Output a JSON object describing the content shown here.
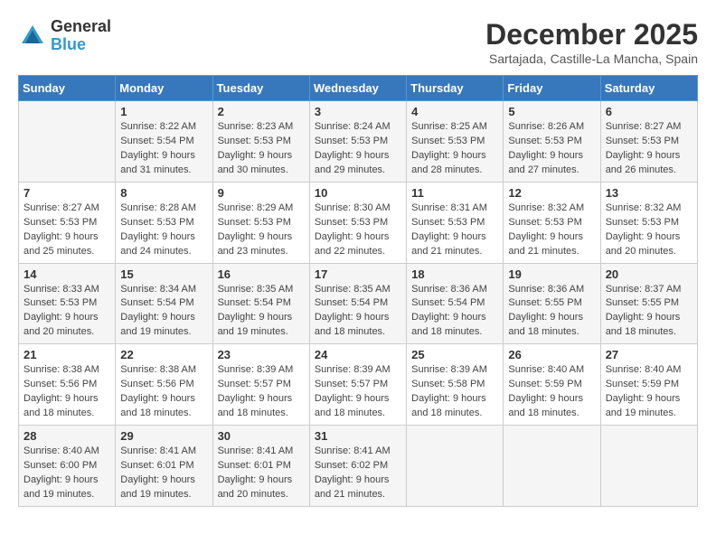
{
  "header": {
    "logo": {
      "general": "General",
      "blue": "Blue"
    },
    "title": "December 2025",
    "location": "Sartajada, Castille-La Mancha, Spain"
  },
  "days_of_week": [
    "Sunday",
    "Monday",
    "Tuesday",
    "Wednesday",
    "Thursday",
    "Friday",
    "Saturday"
  ],
  "weeks": [
    [
      {
        "day": "",
        "info": ""
      },
      {
        "day": "1",
        "info": "Sunrise: 8:22 AM\nSunset: 5:54 PM\nDaylight: 9 hours\nand 31 minutes."
      },
      {
        "day": "2",
        "info": "Sunrise: 8:23 AM\nSunset: 5:53 PM\nDaylight: 9 hours\nand 30 minutes."
      },
      {
        "day": "3",
        "info": "Sunrise: 8:24 AM\nSunset: 5:53 PM\nDaylight: 9 hours\nand 29 minutes."
      },
      {
        "day": "4",
        "info": "Sunrise: 8:25 AM\nSunset: 5:53 PM\nDaylight: 9 hours\nand 28 minutes."
      },
      {
        "day": "5",
        "info": "Sunrise: 8:26 AM\nSunset: 5:53 PM\nDaylight: 9 hours\nand 27 minutes."
      },
      {
        "day": "6",
        "info": "Sunrise: 8:27 AM\nSunset: 5:53 PM\nDaylight: 9 hours\nand 26 minutes."
      }
    ],
    [
      {
        "day": "7",
        "info": "Sunrise: 8:27 AM\nSunset: 5:53 PM\nDaylight: 9 hours\nand 25 minutes."
      },
      {
        "day": "8",
        "info": "Sunrise: 8:28 AM\nSunset: 5:53 PM\nDaylight: 9 hours\nand 24 minutes."
      },
      {
        "day": "9",
        "info": "Sunrise: 8:29 AM\nSunset: 5:53 PM\nDaylight: 9 hours\nand 23 minutes."
      },
      {
        "day": "10",
        "info": "Sunrise: 8:30 AM\nSunset: 5:53 PM\nDaylight: 9 hours\nand 22 minutes."
      },
      {
        "day": "11",
        "info": "Sunrise: 8:31 AM\nSunset: 5:53 PM\nDaylight: 9 hours\nand 21 minutes."
      },
      {
        "day": "12",
        "info": "Sunrise: 8:32 AM\nSunset: 5:53 PM\nDaylight: 9 hours\nand 21 minutes."
      },
      {
        "day": "13",
        "info": "Sunrise: 8:32 AM\nSunset: 5:53 PM\nDaylight: 9 hours\nand 20 minutes."
      }
    ],
    [
      {
        "day": "14",
        "info": "Sunrise: 8:33 AM\nSunset: 5:53 PM\nDaylight: 9 hours\nand 20 minutes."
      },
      {
        "day": "15",
        "info": "Sunrise: 8:34 AM\nSunset: 5:54 PM\nDaylight: 9 hours\nand 19 minutes."
      },
      {
        "day": "16",
        "info": "Sunrise: 8:35 AM\nSunset: 5:54 PM\nDaylight: 9 hours\nand 19 minutes."
      },
      {
        "day": "17",
        "info": "Sunrise: 8:35 AM\nSunset: 5:54 PM\nDaylight: 9 hours\nand 18 minutes."
      },
      {
        "day": "18",
        "info": "Sunrise: 8:36 AM\nSunset: 5:54 PM\nDaylight: 9 hours\nand 18 minutes."
      },
      {
        "day": "19",
        "info": "Sunrise: 8:36 AM\nSunset: 5:55 PM\nDaylight: 9 hours\nand 18 minutes."
      },
      {
        "day": "20",
        "info": "Sunrise: 8:37 AM\nSunset: 5:55 PM\nDaylight: 9 hours\nand 18 minutes."
      }
    ],
    [
      {
        "day": "21",
        "info": "Sunrise: 8:38 AM\nSunset: 5:56 PM\nDaylight: 9 hours\nand 18 minutes."
      },
      {
        "day": "22",
        "info": "Sunrise: 8:38 AM\nSunset: 5:56 PM\nDaylight: 9 hours\nand 18 minutes."
      },
      {
        "day": "23",
        "info": "Sunrise: 8:39 AM\nSunset: 5:57 PM\nDaylight: 9 hours\nand 18 minutes."
      },
      {
        "day": "24",
        "info": "Sunrise: 8:39 AM\nSunset: 5:57 PM\nDaylight: 9 hours\nand 18 minutes."
      },
      {
        "day": "25",
        "info": "Sunrise: 8:39 AM\nSunset: 5:58 PM\nDaylight: 9 hours\nand 18 minutes."
      },
      {
        "day": "26",
        "info": "Sunrise: 8:40 AM\nSunset: 5:59 PM\nDaylight: 9 hours\nand 18 minutes."
      },
      {
        "day": "27",
        "info": "Sunrise: 8:40 AM\nSunset: 5:59 PM\nDaylight: 9 hours\nand 19 minutes."
      }
    ],
    [
      {
        "day": "28",
        "info": "Sunrise: 8:40 AM\nSunset: 6:00 PM\nDaylight: 9 hours\nand 19 minutes."
      },
      {
        "day": "29",
        "info": "Sunrise: 8:41 AM\nSunset: 6:01 PM\nDaylight: 9 hours\nand 19 minutes."
      },
      {
        "day": "30",
        "info": "Sunrise: 8:41 AM\nSunset: 6:01 PM\nDaylight: 9 hours\nand 20 minutes."
      },
      {
        "day": "31",
        "info": "Sunrise: 8:41 AM\nSunset: 6:02 PM\nDaylight: 9 hours\nand 21 minutes."
      },
      {
        "day": "",
        "info": ""
      },
      {
        "day": "",
        "info": ""
      },
      {
        "day": "",
        "info": ""
      }
    ]
  ]
}
